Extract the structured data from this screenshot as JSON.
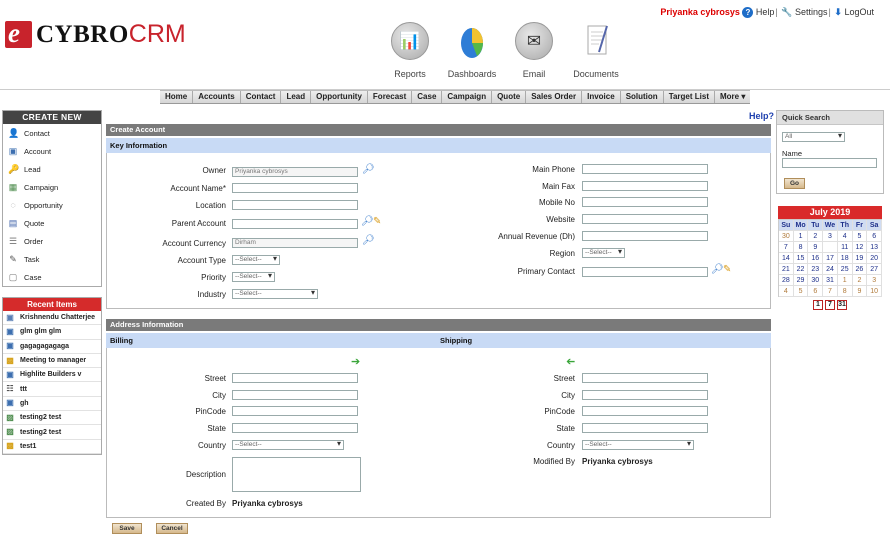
{
  "header": {
    "logo_letter": "e",
    "logo_word1": "CYBRO",
    "logo_word2": "CRM",
    "modules": [
      {
        "label": "Reports",
        "icon": "reports-icon"
      },
      {
        "label": "Dashboards",
        "icon": "dashboards-icon"
      },
      {
        "label": "Email",
        "icon": "email-icon"
      },
      {
        "label": "Documents",
        "icon": "documents-icon"
      }
    ],
    "user_name": "Priyanka cybrosys",
    "help_label": "Help",
    "settings_label": "Settings",
    "logout_label": "LogOut"
  },
  "nav": {
    "items": [
      "Home",
      "Accounts",
      "Contact",
      "Lead",
      "Opportunity",
      "Forecast",
      "Case",
      "Campaign",
      "Quote",
      "Sales Order",
      "Invoice",
      "Solution",
      "Target List",
      "More ▾"
    ]
  },
  "sidebar": {
    "create_title": "CREATE NEW",
    "create_items": [
      {
        "label": "Contact",
        "icon": "contact-icon"
      },
      {
        "label": "Account",
        "icon": "account-icon"
      },
      {
        "label": "Lead",
        "icon": "lead-icon"
      },
      {
        "label": "Campaign",
        "icon": "campaign-icon"
      },
      {
        "label": "Opportunity",
        "icon": "opportunity-icon"
      },
      {
        "label": "Quote",
        "icon": "quote-icon"
      },
      {
        "label": "Order",
        "icon": "order-icon"
      },
      {
        "label": "Task",
        "icon": "task-icon"
      },
      {
        "label": "Case",
        "icon": "case-icon"
      }
    ],
    "recent_title": "Recent Items",
    "recent_items": [
      "Krishnendu Chatterjee",
      "glm glm glm",
      "gagagagagaga",
      "Meeting to manager",
      "Highlite Builders v",
      "ttt",
      "gh",
      "testing2 test",
      "testing2 test",
      "test1"
    ]
  },
  "form": {
    "help_link": "Help?",
    "create_title": "Create Account",
    "key_info_title": "Key Information",
    "owner_label": "Owner",
    "owner_value": "Priyanka cybrosys",
    "account_name_label": "Account Name*",
    "location_label": "Location",
    "parent_account_label": "Parent Account",
    "currency_label": "Account Currency",
    "currency_value": "Dirham",
    "account_type_label": "Account Type",
    "priority_label": "Priority",
    "industry_label": "Industry",
    "select_placeholder": "--Select--",
    "main_phone_label": "Main Phone",
    "main_fax_label": "Main Fax",
    "mobile_label": "Mobile No",
    "website_label": "Website",
    "annual_revenue_label": "Annual Revenue  (Dh)",
    "region_label": "Region",
    "primary_contact_label": "Primary Contact",
    "address_title": "Address Information",
    "billing_title": "Billing",
    "shipping_title": "Shipping",
    "street_label": "Street",
    "city_label": "City",
    "pincode_label": "PinCode",
    "state_label": "State",
    "country_label": "Country",
    "description_label": "Description",
    "created_by_label": "Created By",
    "created_by_value": "Priyanka cybrosys",
    "modified_by_label": "Modified By",
    "modified_by_value": "Priyanka cybrosys",
    "save_label": "Save",
    "cancel_label": "Cancel"
  },
  "quick_search": {
    "title": "Quick Search",
    "filter_value": "All",
    "name_label": "Name",
    "go_label": "Go"
  },
  "calendar": {
    "title": "July 2019",
    "weekdays": [
      "Su",
      "Mo",
      "Tu",
      "We",
      "Th",
      "Fr",
      "Sa"
    ],
    "rows": [
      [
        "30",
        "1",
        "2",
        "3",
        "4",
        "5",
        "6"
      ],
      [
        "7",
        "8",
        "9",
        "",
        "11",
        "12",
        "13"
      ],
      [
        "14",
        "15",
        "16",
        "17",
        "18",
        "19",
        "20"
      ],
      [
        "21",
        "22",
        "23",
        "24",
        "25",
        "26",
        "27"
      ],
      [
        "28",
        "29",
        "30",
        "31",
        "1",
        "2",
        "3"
      ],
      [
        "4",
        "5",
        "6",
        "7",
        "8",
        "9",
        "10"
      ]
    ],
    "footer": [
      "1",
      "7",
      "31"
    ]
  }
}
